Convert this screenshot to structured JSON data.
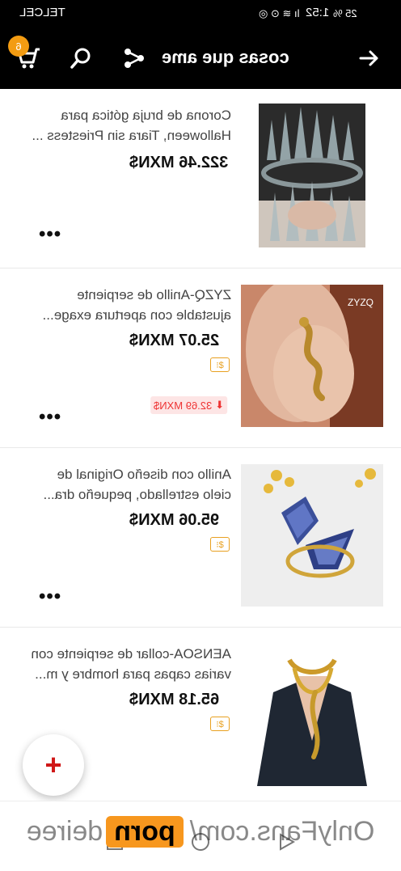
{
  "status_bar": {
    "carrier": "TELCEL",
    "time": "1:52",
    "battery": "25 %"
  },
  "header": {
    "title": "cosas que ame",
    "cart_count": "6",
    "background": "#000000",
    "icons": [
      "back-arrow-icon",
      "share-icon",
      "search-icon",
      "cart-icon"
    ]
  },
  "items": [
    {
      "name_line1": "Corona de bruja gótica para",
      "name_line2": "Halloween, Tiara sin Priestess ...",
      "price": "322.46 MXN$",
      "more": "•••",
      "has_coin": false,
      "image": "crystal-crown-photo"
    },
    {
      "name_line1": "ZYZQ-Anillo de serpiente",
      "name_line2": "ajustable con apertura exage...",
      "price": "25.07 MXN$",
      "coin_icon": "coin-icon",
      "more": "•••",
      "price_drop": "32.69 MXN$",
      "image": "snake-ring-photo"
    },
    {
      "name_line1": "Anillo con diseño Original de",
      "name_line2": "cielo estrellado, pequeño dra...",
      "price": "95.06 MXN$",
      "coin_icon": "coin-icon",
      "more": "•••",
      "image": "dragon-ring-photo"
    },
    {
      "name_line1": "AENSOA-collar de serpiente con",
      "name_line2": "varias capas para hombre y m...",
      "price": "65.18 MXN$",
      "coin_icon": "coin-icon",
      "more": "•••",
      "image": "snake-necklace-photo"
    }
  ],
  "fab": {
    "label": "+",
    "color": "#d01818"
  },
  "watermark": {
    "part1": "OnlyFans.com/",
    "part2": "porn",
    "part3": "deiree"
  },
  "nav": {
    "icons": [
      "square-icon",
      "circle-icon",
      "triangle-icon"
    ]
  },
  "colors": {
    "accent": "#f39c12",
    "price_drop": "#e33333"
  }
}
